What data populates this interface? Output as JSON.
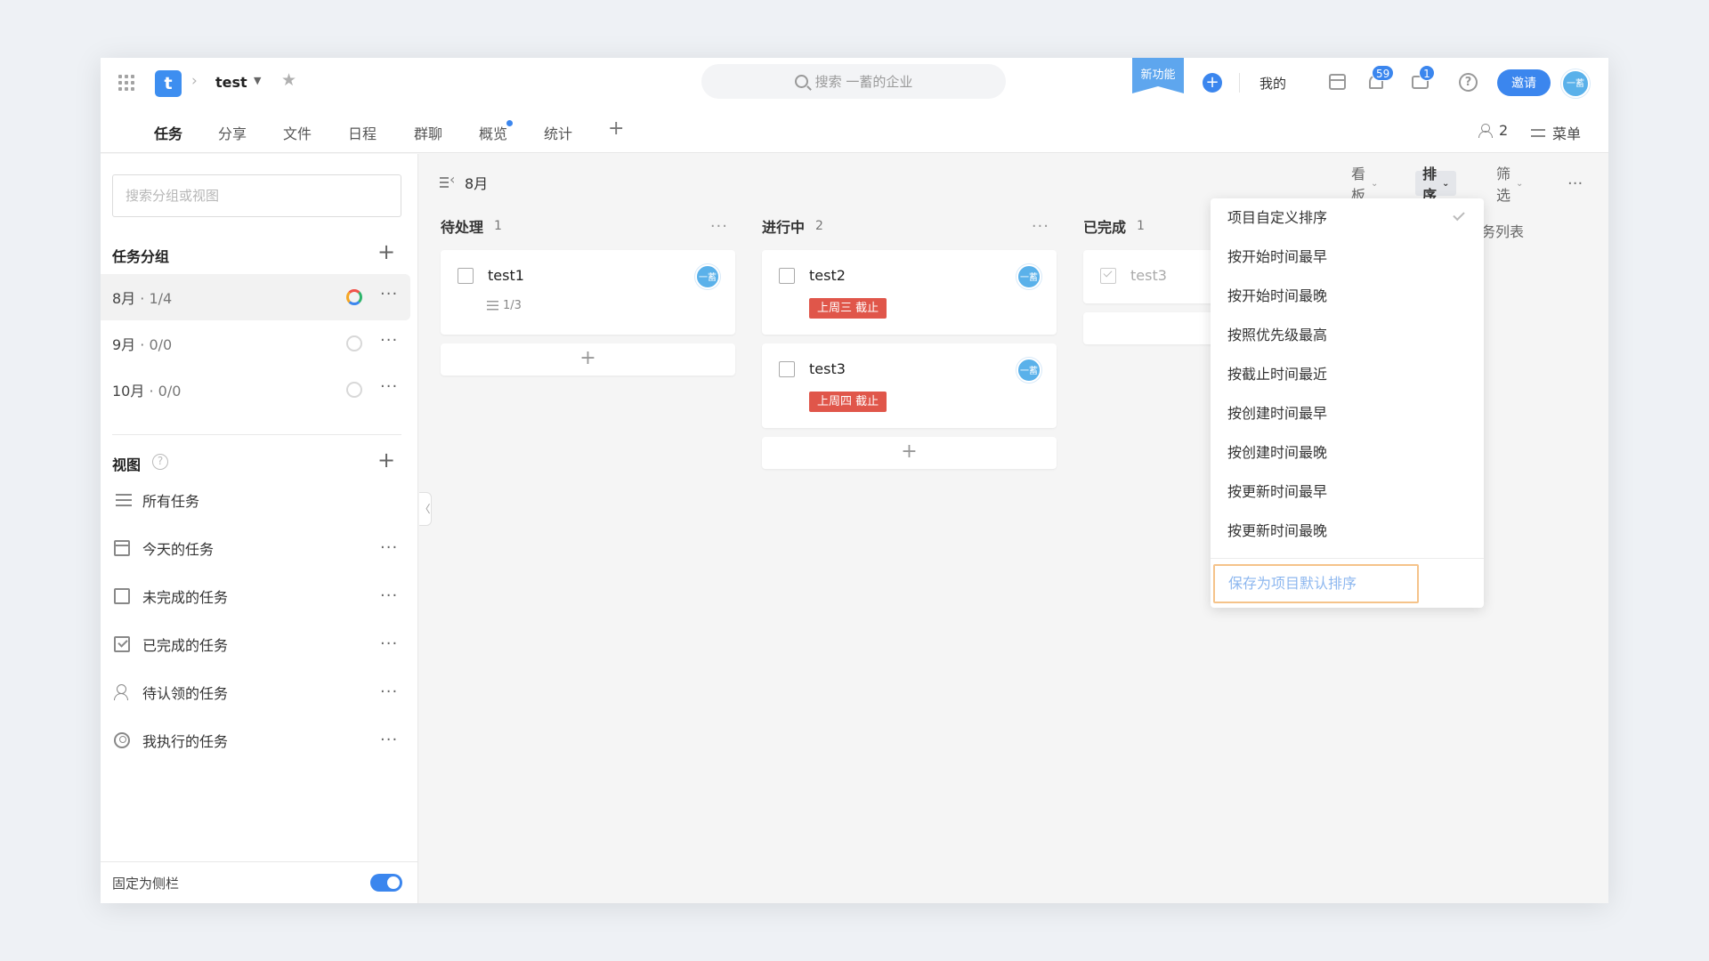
{
  "topbar": {
    "project_name": "test",
    "search_placeholder": "搜索 一蓄的企业",
    "new_feature": "新功能",
    "mine": "我的",
    "notif_count": "59",
    "msg_count": "1",
    "invite": "邀请",
    "avatar_text": "一蓄",
    "logo_letter": "t",
    "plus": "+",
    "help": "?"
  },
  "tabs": [
    {
      "label": "任务",
      "active": true
    },
    {
      "label": "分享"
    },
    {
      "label": "文件"
    },
    {
      "label": "日程"
    },
    {
      "label": "群聊"
    },
    {
      "label": "概览",
      "dot": true
    },
    {
      "label": "统计"
    }
  ],
  "tab_add": "+",
  "header_right": {
    "member_count": "2",
    "menu": "菜单"
  },
  "sidebar": {
    "search_placeholder": "搜索分组或视图",
    "groups_title": "任务分组",
    "groups": [
      {
        "name": "8月",
        "count": "1/4"
      },
      {
        "name": "9月",
        "count": "0/0"
      },
      {
        "name": "10月",
        "count": "0/0"
      }
    ],
    "views_title": "视图",
    "views": [
      {
        "label": "所有任务",
        "icon": "list-icon"
      },
      {
        "label": "今天的任务",
        "icon": "calendar-icon"
      },
      {
        "label": "未完成的任务",
        "icon": "checkbox-icon"
      },
      {
        "label": "已完成的任务",
        "icon": "checked-box-icon"
      },
      {
        "label": "待认领的任务",
        "icon": "person-icon"
      },
      {
        "label": "我执行的任务",
        "icon": "user-circle-icon"
      }
    ],
    "pin_label": "固定为侧栏",
    "pin_on": true,
    "add": "+",
    "more": "···",
    "help": "?",
    "collapse": "〈"
  },
  "board": {
    "title": "8月",
    "tools": {
      "view": "看板",
      "sort": "排序",
      "filter": "筛选",
      "chevron": "⌄",
      "more": "···"
    },
    "columns": [
      {
        "name": "待处理",
        "count": "1"
      },
      {
        "name": "进行中",
        "count": "2"
      },
      {
        "name": "已完成",
        "count": "1"
      }
    ],
    "cards": [
      {
        "title": "test1",
        "subtasks": "1/3",
        "avatar": "一蓄"
      },
      {
        "title": "test2",
        "due": "上周三 截止",
        "avatar": "一蓄"
      },
      {
        "title": "test3",
        "due": "上周四 截止",
        "avatar": "一蓄"
      },
      {
        "title": "test3",
        "done": true
      }
    ],
    "add_card": "+",
    "peek_label": "务列表"
  },
  "sort_menu": {
    "items": [
      {
        "label": "项目自定义排序",
        "checked": true
      },
      {
        "label": "按开始时间最早"
      },
      {
        "label": "按开始时间最晚"
      },
      {
        "label": "按照优先级最高"
      },
      {
        "label": "按截止时间最近"
      },
      {
        "label": "按创建时间最早"
      },
      {
        "label": "按创建时间最晚"
      },
      {
        "label": "按更新时间最早"
      },
      {
        "label": "按更新时间最晚"
      }
    ],
    "save_default": "保存为项目默认排序"
  },
  "colors": {
    "accent": "#3b86ee",
    "due_tag": "#e0564a",
    "highlight_border": "#f5c38a"
  }
}
